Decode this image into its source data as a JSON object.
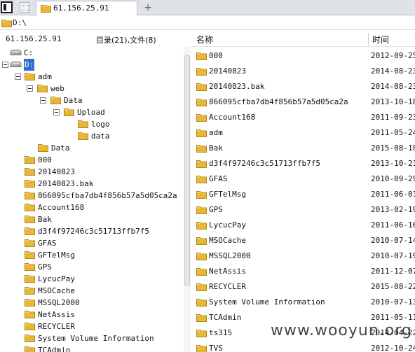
{
  "tab": {
    "label": "61.156.25.91"
  },
  "address": "D:\\",
  "left": {
    "host": "61.156.25.91",
    "counts": "目录(21),文件(8)"
  },
  "tree": {
    "drives": [
      "C:",
      "D:"
    ],
    "adm": "adm",
    "web": "web",
    "data_cap": "Data",
    "upload": "Upload",
    "logo": "logo",
    "data_lower": "data",
    "data_root": "Data",
    "folders": [
      "000",
      "20140823",
      "20140823.bak",
      "866095cfba7db4f856b57a5d05ca2a",
      "Account168",
      "Bak",
      "d3f4f97246c3c51713ffb7f5",
      "GFAS",
      "GFTelMsg",
      "GPS",
      "LycucPay",
      "MSOCache",
      "MSSQL2000",
      "NetAssis",
      "RECYCLER",
      "System Volume Information",
      "TCAdmin"
    ]
  },
  "list": {
    "col_name": "名称",
    "col_time": "时间",
    "rows": [
      {
        "name": "000",
        "time": "2012-09-25"
      },
      {
        "name": "20140823",
        "time": "2014-08-23"
      },
      {
        "name": "20140823.bak",
        "time": "2014-08-23"
      },
      {
        "name": "866095cfba7db4f856b57a5d05ca2a",
        "time": "2013-10-18"
      },
      {
        "name": "Account168",
        "time": "2011-09-23"
      },
      {
        "name": "adm",
        "time": "2011-05-24"
      },
      {
        "name": "Bak",
        "time": "2015-08-18"
      },
      {
        "name": "d3f4f97246c3c51713ffb7f5",
        "time": "2013-10-21"
      },
      {
        "name": "GFAS",
        "time": "2010-09-29"
      },
      {
        "name": "GFTelMsg",
        "time": "2011-06-01"
      },
      {
        "name": "GPS",
        "time": "2013-02-19"
      },
      {
        "name": "LycucPay",
        "time": "2011-06-16"
      },
      {
        "name": "MSOCache",
        "time": "2010-07-14"
      },
      {
        "name": "MSSQL2000",
        "time": "2010-07-19"
      },
      {
        "name": "NetAssis",
        "time": "2011-12-07"
      },
      {
        "name": "RECYCLER",
        "time": "2015-08-22"
      },
      {
        "name": "System Volume Information",
        "time": "2010-07-13"
      },
      {
        "name": "TCAdmin",
        "time": "2011-05-11"
      },
      {
        "name": "ts315",
        "time": "2014-04-22"
      },
      {
        "name": "TVS",
        "time": "2012-10-24"
      }
    ]
  },
  "watermark": "www.wooyun.org",
  "colors": {
    "folder": "#e8b736",
    "selection": "#2f6fd3"
  }
}
